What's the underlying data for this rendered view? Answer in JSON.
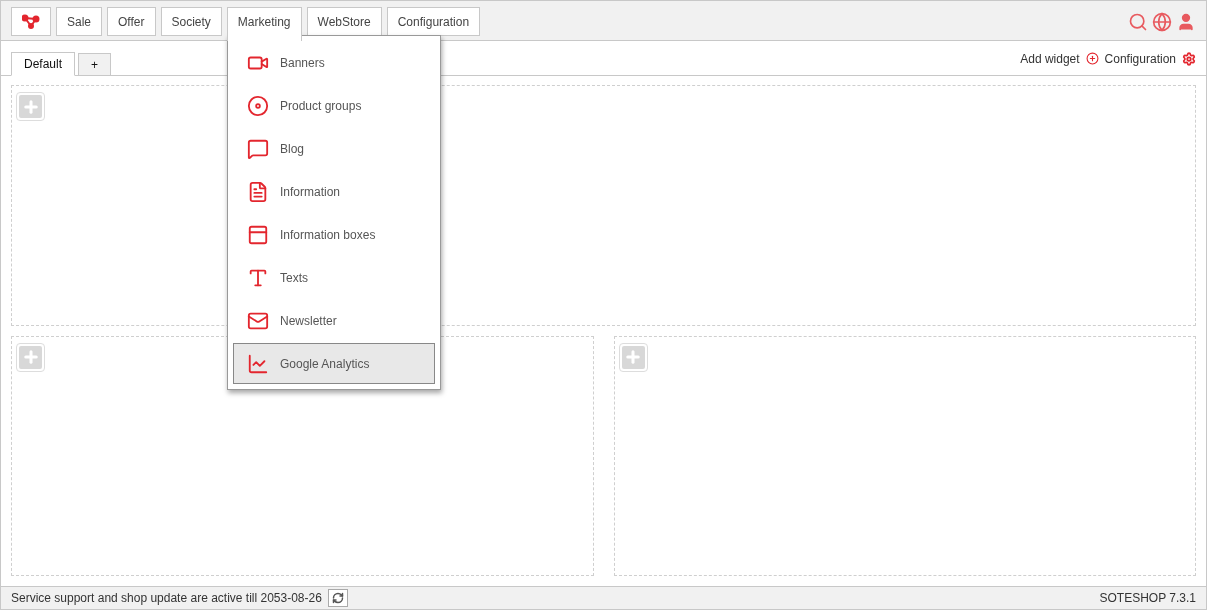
{
  "top_nav": {
    "items": [
      {
        "label": "Sale",
        "selected": false
      },
      {
        "label": "Offer",
        "selected": false
      },
      {
        "label": "Society",
        "selected": false
      },
      {
        "label": "Marketing",
        "selected": true
      },
      {
        "label": "WebStore",
        "selected": false
      },
      {
        "label": "Configuration",
        "selected": false
      }
    ]
  },
  "dropdown": {
    "items": [
      {
        "label": "Banners",
        "selected": false
      },
      {
        "label": "Product groups",
        "selected": false
      },
      {
        "label": "Blog",
        "selected": false
      },
      {
        "label": "Information",
        "selected": false
      },
      {
        "label": "Information boxes",
        "selected": false
      },
      {
        "label": "Texts",
        "selected": false
      },
      {
        "label": "Newsletter",
        "selected": false
      },
      {
        "label": "Google Analytics",
        "selected": true
      }
    ]
  },
  "dashboard_tabs": [
    {
      "label": "Default",
      "selected": true
    },
    {
      "label": "+",
      "selected": false
    }
  ],
  "toolbar": {
    "add_widget": "Add widget",
    "configuration": "Configuration"
  },
  "status_bar": {
    "message": "Service support and shop update are active till 2053-08-26",
    "version": "SOTESHOP 7.3.1"
  }
}
